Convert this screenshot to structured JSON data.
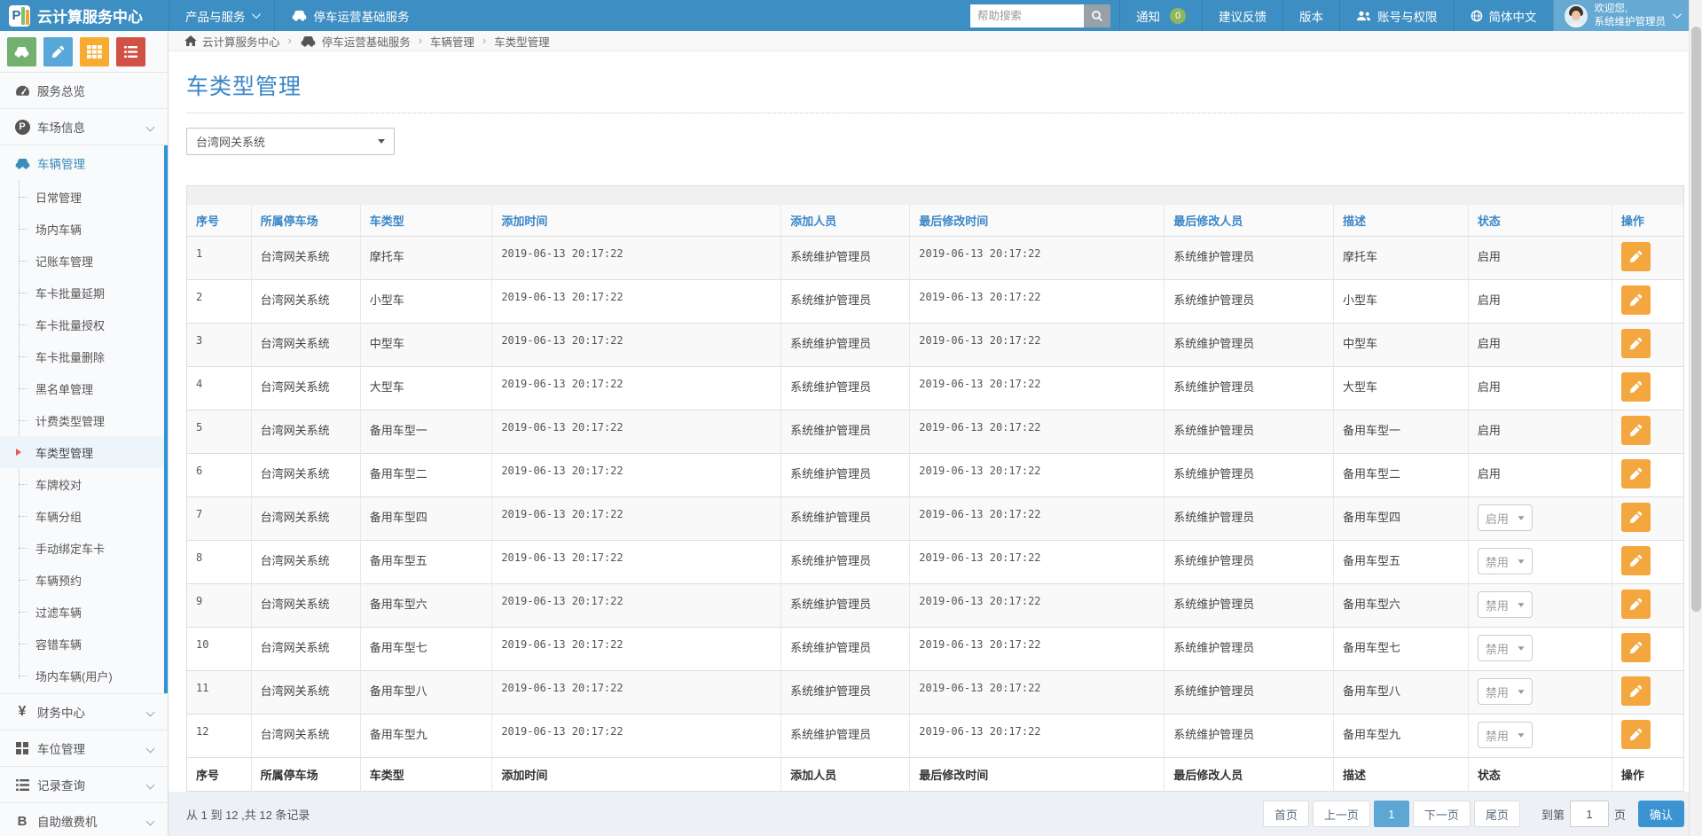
{
  "colors": {
    "navbar": "#3d8ec2",
    "accent": "#3a87c8",
    "active_bar": "#2f93d6",
    "warning": "#f3a73e",
    "badge": "#8eb65c",
    "pagination_active": "#5ea7d4",
    "confirm": "#3b94d1"
  },
  "navbar": {
    "logo_letter": "P",
    "brand": "云计算服务中心",
    "menu": [
      {
        "key": "products",
        "label": "产品与服务",
        "caret": true
      },
      {
        "key": "parking-ops",
        "label": "停车运营基础服务",
        "icon": "car"
      }
    ],
    "search_placeholder": "帮助搜索",
    "items": [
      {
        "key": "notifications",
        "label": "通知",
        "badge": "0"
      },
      {
        "key": "feedback",
        "label": "建议反馈"
      },
      {
        "key": "version",
        "label": "版本"
      },
      {
        "key": "account-permissions",
        "label": "账号与权限",
        "icon": "users"
      },
      {
        "key": "language",
        "label": "简体中文",
        "icon": "globe"
      }
    ],
    "user": {
      "greeting": "欢迎您,",
      "name": "系统维护管理员"
    }
  },
  "sidebar": {
    "shortcuts": [
      {
        "key": "vehicle",
        "icon": "car",
        "color": "#71b06e"
      },
      {
        "key": "edit",
        "icon": "pencil",
        "color": "#57a7d8"
      },
      {
        "key": "table",
        "icon": "grid3",
        "color": "#f7ab31"
      },
      {
        "key": "list",
        "icon": "list",
        "color": "#d25145"
      }
    ],
    "items": [
      {
        "key": "overview",
        "icon": "gauge",
        "label": "服务总览"
      },
      {
        "key": "lot-info",
        "icon": "parking",
        "label": "车场信息",
        "chevron": true
      },
      {
        "key": "vehicle-mgmt",
        "icon": "car",
        "label": "车辆管理",
        "active": true,
        "submenu": [
          {
            "label": "日常管理"
          },
          {
            "label": "场内车辆"
          },
          {
            "label": "记账车管理"
          },
          {
            "label": "车卡批量延期"
          },
          {
            "label": "车卡批量授权"
          },
          {
            "label": "车卡批量删除"
          },
          {
            "label": "黑名单管理"
          },
          {
            "label": "计费类型管理"
          },
          {
            "label": "车类型管理",
            "active": true
          },
          {
            "label": "车牌校对"
          },
          {
            "label": "车辆分组"
          },
          {
            "label": "手动绑定车卡"
          },
          {
            "label": "车辆预约"
          },
          {
            "label": "过滤车辆"
          },
          {
            "label": "容错车辆"
          },
          {
            "label": "场内车辆(用户)"
          }
        ]
      },
      {
        "key": "finance",
        "icon": "yen",
        "label": "财务中心",
        "chevron": true
      },
      {
        "key": "space-mgmt",
        "icon": "grid2",
        "label": "车位管理",
        "chevron": true
      },
      {
        "key": "records",
        "icon": "list-dark",
        "label": "记录查询",
        "chevron": true
      },
      {
        "key": "kiosk",
        "icon": "bitcoin",
        "label": "自助缴费机",
        "chevron": true
      }
    ]
  },
  "breadcrumb": {
    "items": [
      {
        "label": "云计算服务中心",
        "icon": "home"
      },
      {
        "label": "停车运营基础服务",
        "icon": "car"
      },
      {
        "label": "车辆管理"
      },
      {
        "label": "车类型管理"
      }
    ]
  },
  "page": {
    "title": "车类型管理"
  },
  "filter": {
    "selected": "台湾网关系统"
  },
  "table": {
    "columns": [
      "序号",
      "所属停车场",
      "车类型",
      "添加时间",
      "添加人员",
      "最后修改时间",
      "最后修改人员",
      "描述",
      "状态",
      "操作"
    ],
    "rows": [
      {
        "no": "1",
        "lot": "台湾网关系统",
        "type": "摩托车",
        "added_time": "2019-06-13 20:17:22",
        "added_by": "系统维护管理员",
        "modified_time": "2019-06-13 20:17:22",
        "modified_by": "系统维护管理员",
        "desc": "摩托车",
        "status": "启用",
        "status_control": "text"
      },
      {
        "no": "2",
        "lot": "台湾网关系统",
        "type": "小型车",
        "added_time": "2019-06-13 20:17:22",
        "added_by": "系统维护管理员",
        "modified_time": "2019-06-13 20:17:22",
        "modified_by": "系统维护管理员",
        "desc": "小型车",
        "status": "启用",
        "status_control": "text"
      },
      {
        "no": "3",
        "lot": "台湾网关系统",
        "type": "中型车",
        "added_time": "2019-06-13 20:17:22",
        "added_by": "系统维护管理员",
        "modified_time": "2019-06-13 20:17:22",
        "modified_by": "系统维护管理员",
        "desc": "中型车",
        "status": "启用",
        "status_control": "text"
      },
      {
        "no": "4",
        "lot": "台湾网关系统",
        "type": "大型车",
        "added_time": "2019-06-13 20:17:22",
        "added_by": "系统维护管理员",
        "modified_time": "2019-06-13 20:17:22",
        "modified_by": "系统维护管理员",
        "desc": "大型车",
        "status": "启用",
        "status_control": "text"
      },
      {
        "no": "5",
        "lot": "台湾网关系统",
        "type": "备用车型一",
        "added_time": "2019-06-13 20:17:22",
        "added_by": "系统维护管理员",
        "modified_time": "2019-06-13 20:17:22",
        "modified_by": "系统维护管理员",
        "desc": "备用车型一",
        "status": "启用",
        "status_control": "text"
      },
      {
        "no": "6",
        "lot": "台湾网关系统",
        "type": "备用车型二",
        "added_time": "2019-06-13 20:17:22",
        "added_by": "系统维护管理员",
        "modified_time": "2019-06-13 20:17:22",
        "modified_by": "系统维护管理员",
        "desc": "备用车型二",
        "status": "启用",
        "status_control": "text"
      },
      {
        "no": "7",
        "lot": "台湾网关系统",
        "type": "备用车型四",
        "added_time": "2019-06-13 20:17:22",
        "added_by": "系统维护管理员",
        "modified_time": "2019-06-13 20:17:22",
        "modified_by": "系统维护管理员",
        "desc": "备用车型四",
        "status": "启用",
        "status_control": "select"
      },
      {
        "no": "8",
        "lot": "台湾网关系统",
        "type": "备用车型五",
        "added_time": "2019-06-13 20:17:22",
        "added_by": "系统维护管理员",
        "modified_time": "2019-06-13 20:17:22",
        "modified_by": "系统维护管理员",
        "desc": "备用车型五",
        "status": "禁用",
        "status_control": "select"
      },
      {
        "no": "9",
        "lot": "台湾网关系统",
        "type": "备用车型六",
        "added_time": "2019-06-13 20:17:22",
        "added_by": "系统维护管理员",
        "modified_time": "2019-06-13 20:17:22",
        "modified_by": "系统维护管理员",
        "desc": "备用车型六",
        "status": "禁用",
        "status_control": "select"
      },
      {
        "no": "10",
        "lot": "台湾网关系统",
        "type": "备用车型七",
        "added_time": "2019-06-13 20:17:22",
        "added_by": "系统维护管理员",
        "modified_time": "2019-06-13 20:17:22",
        "modified_by": "系统维护管理员",
        "desc": "备用车型七",
        "status": "禁用",
        "status_control": "select"
      },
      {
        "no": "11",
        "lot": "台湾网关系统",
        "type": "备用车型八",
        "added_time": "2019-06-13 20:17:22",
        "added_by": "系统维护管理员",
        "modified_time": "2019-06-13 20:17:22",
        "modified_by": "系统维护管理员",
        "desc": "备用车型八",
        "status": "禁用",
        "status_control": "select"
      },
      {
        "no": "12",
        "lot": "台湾网关系统",
        "type": "备用车型九",
        "added_time": "2019-06-13 20:17:22",
        "added_by": "系统维护管理员",
        "modified_time": "2019-06-13 20:17:22",
        "modified_by": "系统维护管理员",
        "desc": "备用车型九",
        "status": "禁用",
        "status_control": "select"
      }
    ]
  },
  "pagination": {
    "summary": "从 1 到 12 ,共 12 条记录",
    "first": "首页",
    "prev": "上一页",
    "current": "1",
    "next": "下一页",
    "last": "尾页",
    "goto_label": "到第",
    "goto_value": "1",
    "goto_unit": "页",
    "confirm": "确认"
  }
}
